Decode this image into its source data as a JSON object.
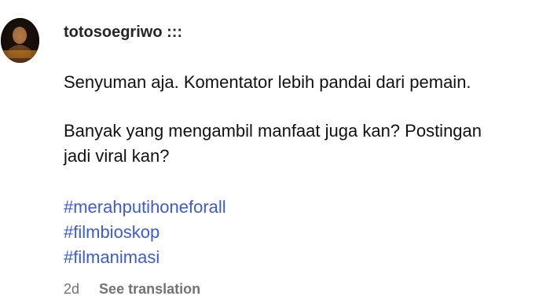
{
  "comment": {
    "username": "totosoegriwo :::",
    "paragraph_1": "Senyuman aja. Komentator lebih pandai dari pemain.",
    "paragraph_2_line_1": "Banyak yang mengambil manfaat juga kan? Postingan",
    "paragraph_2_line_2": "jadi viral kan?",
    "hashtags": [
      "#merahputihoneforall",
      "#filmbioskop",
      "#filmanimasi"
    ],
    "time": "2d",
    "see_translation": "See translation"
  },
  "avatar": {
    "icon": "user-avatar",
    "colors": {
      "dark": "#2b1c12",
      "skin": "#b47a45",
      "accent": "#d98a2b"
    }
  }
}
